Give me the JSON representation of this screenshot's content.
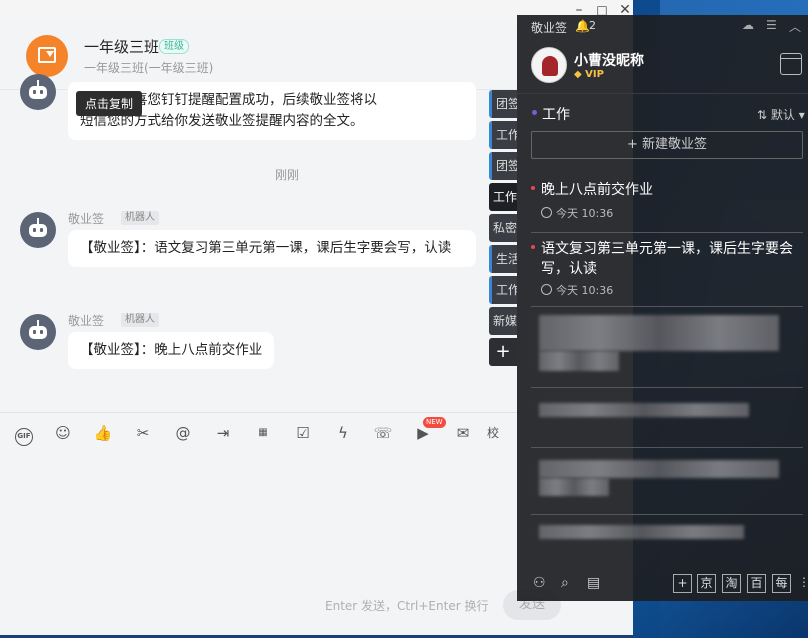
{
  "chat": {
    "group_name": "一年级三班",
    "group_tag": "班级",
    "group_sub": "一年级三班(一年级三班)",
    "tooltip": "点击复制",
    "partial_message": "您好，恭喜您钉钉提醒配置成功，后续敬业签将以\n短信您的方式给你发送敬业签提醒内容的全文。",
    "timestamp": "刚刚",
    "messages": [
      {
        "sender": "敬业签",
        "tag": "机器人",
        "text": "【敬业签】：语文复习第三单元第一课，课后生字要会写，认读"
      },
      {
        "sender": "敬业签",
        "tag": "机器人",
        "text": "【敬业签】：晚上八点前交作业"
      }
    ],
    "send_hint": "Enter 发送，Ctrl+Enter 换行",
    "send_label": "发送",
    "new_badge": "NEW",
    "toolbar_icons": [
      "gif-icon",
      "emoji-icon",
      "thumbs-up-icon",
      "scissors-icon",
      "at-icon",
      "forward-icon",
      "calendar-25-icon",
      "checkbox-icon",
      "lightning-icon",
      "call-icon",
      "video-icon",
      "mail-icon",
      "school-icon"
    ]
  },
  "side_tabs": [
    {
      "label": "团签",
      "accent": true
    },
    {
      "label": "工作",
      "accent": true
    },
    {
      "label": "团签",
      "accent": true
    },
    {
      "label": "工作",
      "active": true
    },
    {
      "label": "私密"
    },
    {
      "label": "生活",
      "accent": true
    },
    {
      "label": "工作",
      "accent": true
    },
    {
      "label": "新媒"
    }
  ],
  "side_add": "+",
  "panel": {
    "title": "敬业签",
    "bell_count": "2",
    "user_name": "小曹没昵称",
    "vip": "VIP",
    "category": "工作",
    "sort_label": "默认",
    "new_note": "+ 新建敬业签",
    "notes": [
      {
        "text": "晚上八点前交作业",
        "time": "今天  10:36"
      },
      {
        "text": "语文复习第三单元第一课，课后生字要会写，认读",
        "time": "今天  10:36"
      }
    ],
    "shortcuts": [
      "+",
      "京",
      "淘",
      "百",
      "每"
    ]
  },
  "colors": {
    "accent_purple": "#7e5bd6",
    "red_dot": "#e5484d",
    "vip_gold": "#f5c242",
    "avatar_orange": "#f5832a"
  }
}
